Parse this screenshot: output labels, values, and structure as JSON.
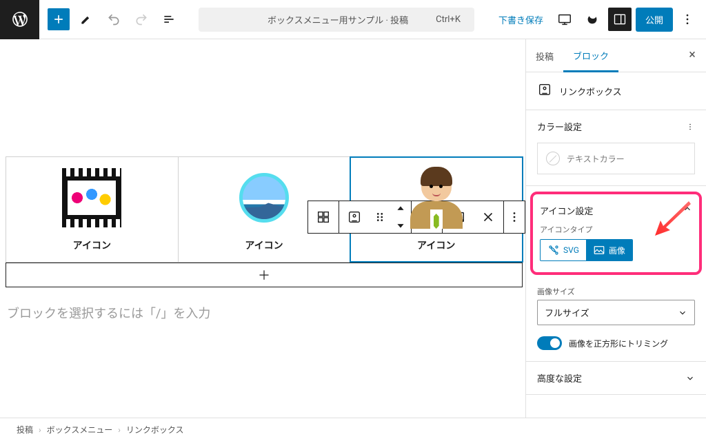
{
  "header": {
    "title_text": "ボックスメニュー用サンプル · 投稿",
    "shortcut": "Ctrl+K",
    "save_draft": "下書き保存",
    "publish": "公開"
  },
  "canvas": {
    "columns": [
      {
        "label": "アイコン"
      },
      {
        "label": "アイコン"
      },
      {
        "label": "アイコン"
      }
    ],
    "add_symbol": "＋",
    "placeholder": "ブロックを選択するには「/」を入力"
  },
  "sidebar": {
    "tab_post": "投稿",
    "tab_block": "ブロック",
    "block_name": "リンクボックス",
    "section_color": "カラー設定",
    "color_text_label": "テキストカラー",
    "section_icon": "アイコン設定",
    "icon_type_label": "アイコンタイプ",
    "type_svg": "SVG",
    "type_image": "画像",
    "image_size_label": "画像サイズ",
    "image_size_value": "フルサイズ",
    "image_crop_label": "画像を正方形にトリミング",
    "section_advanced": "高度な設定"
  },
  "breadcrumb": {
    "level1": "投稿",
    "level2": "ボックスメニュー",
    "level3": "リンクボックス"
  }
}
